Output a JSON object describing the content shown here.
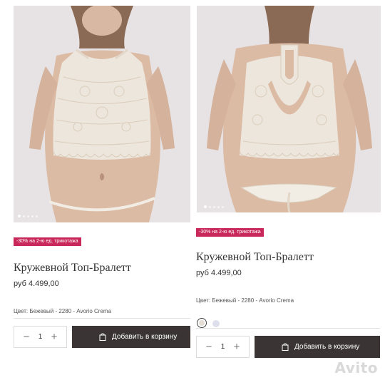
{
  "products": [
    {
      "promo_badge": "-30% на 2-ю ед. трикотажа",
      "title": "Кружевной Топ-Бралетт",
      "price": "руб 4.499,00",
      "color_label": "Цвет: Бежевый - 2280 - Avorio Crema",
      "quantity": "1",
      "add_to_cart_label": "Добавить в корзину",
      "carousel_dots": 5,
      "active_dot_index": 0
    },
    {
      "promo_badge": "-30% на 2-ю ед. трикотажа",
      "title": "Кружевной Топ-Бралетт",
      "price": "руб 4.499,00",
      "color_label": "Цвет: Бежевый - 2280 - Avorio Crema",
      "quantity": "1",
      "add_to_cart_label": "Добавить в корзину",
      "carousel_dots": 5,
      "active_dot_index": 0,
      "swatch_colors": [
        "#e4ddd3",
        "#dedfec"
      ]
    }
  ],
  "stepper": {
    "minus": "−",
    "plus": "+"
  },
  "icons": {
    "cart": "shopping-bag-icon",
    "minus": "minus-icon",
    "plus": "plus-icon"
  },
  "colors": {
    "promo": "#c8285a",
    "button": "#3a3434",
    "lace": "#e9e1d6"
  },
  "watermark": "Avito"
}
